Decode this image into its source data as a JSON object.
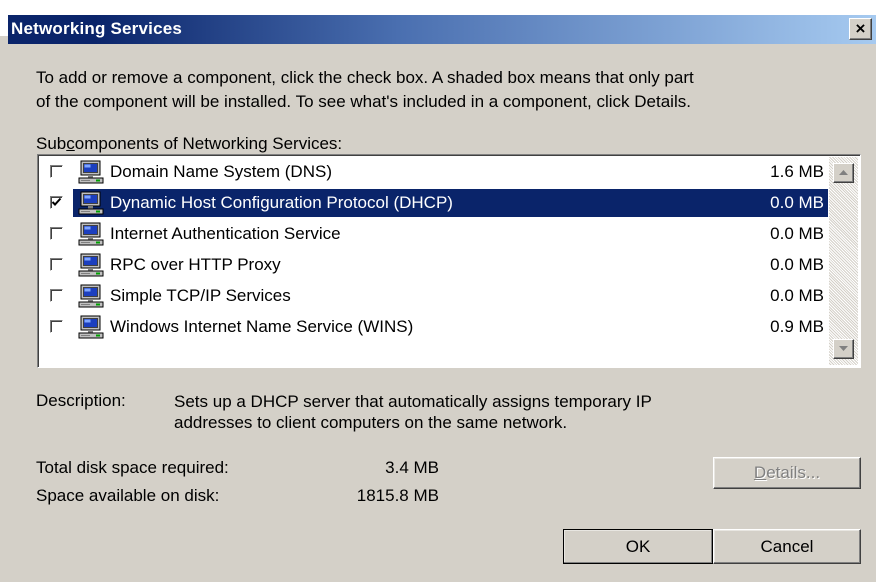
{
  "window": {
    "title": "Networking Services",
    "close_glyph": "×",
    "accent_color": "#0a246a",
    "face_color": "#d4d0c8"
  },
  "intro": {
    "line1": "To add or remove a component, click the check box. A shaded box means that only part",
    "line2": "of the component will be installed. To see what's included in a component, click Details."
  },
  "subcomponents_label": {
    "before": "Sub",
    "mnemonic": "c",
    "after": "omponents of Networking Services:"
  },
  "components": [
    {
      "name": "Domain Name System (DNS)",
      "size": "1.6 MB",
      "checked": false,
      "selected": false,
      "icon": "computer-icon"
    },
    {
      "name": "Dynamic Host Configuration Protocol (DHCP)",
      "size": "0.0 MB",
      "checked": true,
      "selected": true,
      "icon": "computer-icon"
    },
    {
      "name": "Internet Authentication Service",
      "size": "0.0 MB",
      "checked": false,
      "selected": false,
      "icon": "computer-icon"
    },
    {
      "name": "RPC over HTTP Proxy",
      "size": "0.0 MB",
      "checked": false,
      "selected": false,
      "icon": "computer-icon"
    },
    {
      "name": "Simple TCP/IP Services",
      "size": "0.0 MB",
      "checked": false,
      "selected": false,
      "icon": "computer-icon"
    },
    {
      "name": "Windows Internet Name Service (WINS)",
      "size": "0.9 MB",
      "checked": false,
      "selected": false,
      "icon": "computer-icon"
    }
  ],
  "description": {
    "label": "Description:",
    "line1": "Sets up a DHCP server that automatically assigns temporary IP",
    "line2": "addresses to client computers on the same network."
  },
  "disk": {
    "required_label": "Total disk space required:",
    "required_value": "3.4 MB",
    "available_label": "Space available on disk:",
    "available_value": "1815.8 MB"
  },
  "buttons": {
    "details_mnemonic": "D",
    "details_rest": "etails...",
    "details_enabled": false,
    "ok": "OK",
    "cancel": "Cancel"
  }
}
